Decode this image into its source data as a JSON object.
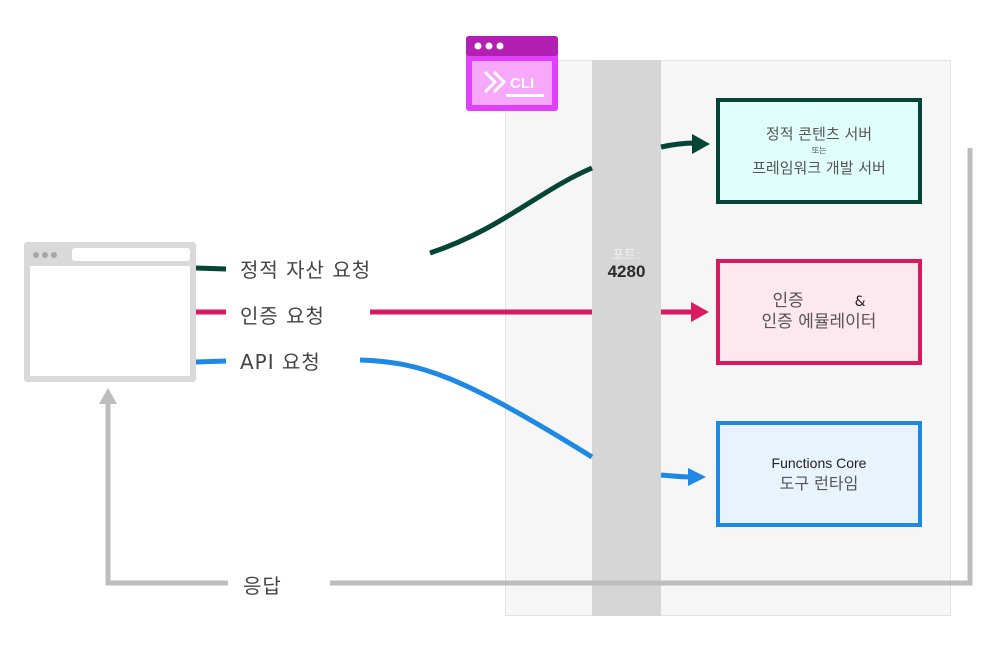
{
  "diagram": {
    "cli_badge": {
      "label": "CLI",
      "icon": "terminal-window-icon"
    },
    "port": {
      "label": "포트:",
      "number": "4280"
    },
    "requests": {
      "static_assets": "정적 자산 요청",
      "auth": "인증 요청",
      "api": "API 요청",
      "response": "응답"
    },
    "targets": {
      "static": {
        "line1": "정적 콘텐츠 서버",
        "connector": "또는",
        "line2": "프레임워크 개발 서버"
      },
      "auth": {
        "line1": "인증",
        "ampersand": "&",
        "line2": "인증 에뮬레이터"
      },
      "functions": {
        "line1": "Functions Core",
        "line2": "도구 런타임"
      }
    },
    "colors": {
      "static": "#054535",
      "auth": "#d81b60",
      "api": "#1e88e5",
      "response": "#bdbdbd",
      "cli": "#e040fb"
    },
    "browser": {
      "icon": "browser-window-icon"
    }
  }
}
